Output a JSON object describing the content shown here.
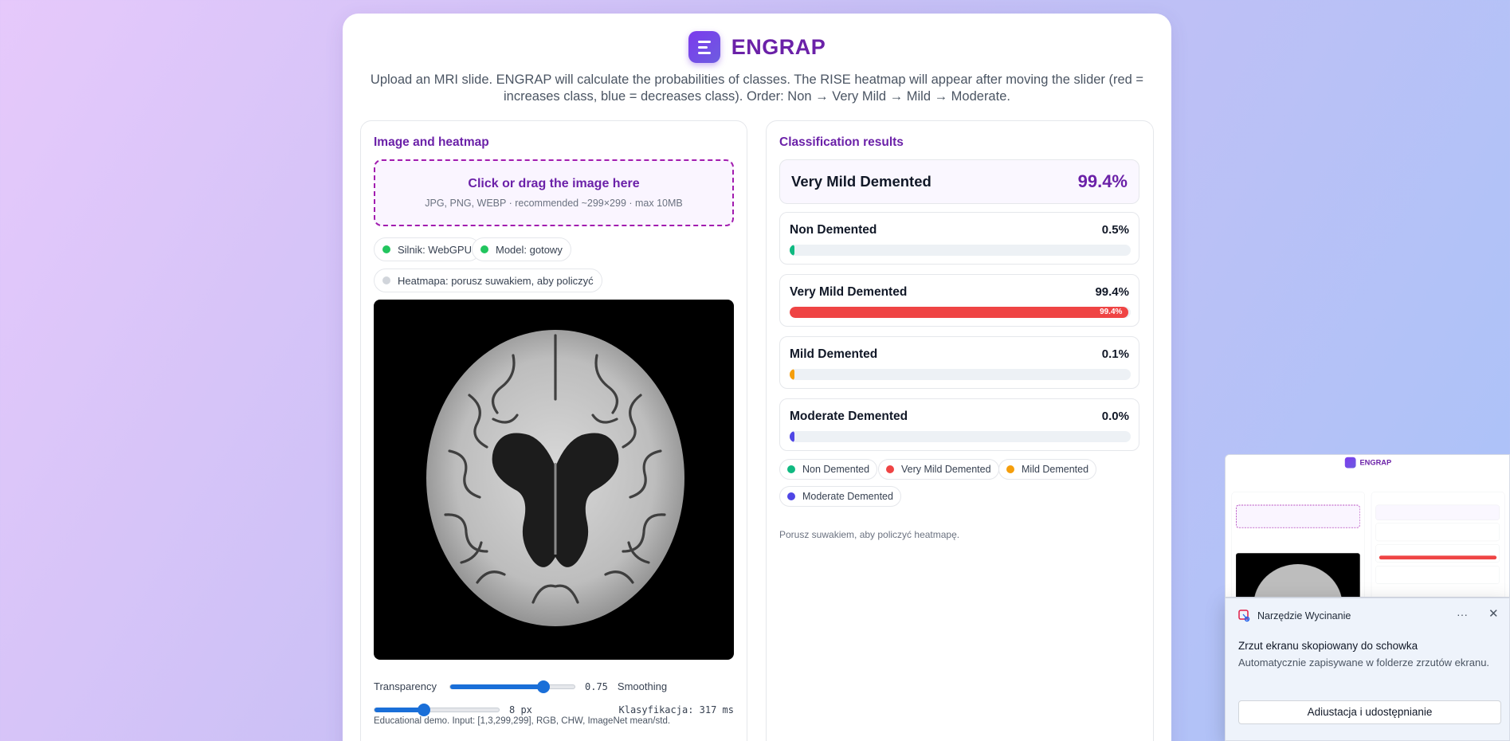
{
  "header": {
    "title": "ENGRAP",
    "subtitle": "Upload an MRI slide. ENGRAP will calculate the probabilities of classes. The RISE heatmap will appear after moving the slider (red = increases class, blue = decreases class). Order: Non → Very Mild → Mild → Moderate."
  },
  "left_panel": {
    "title": "Image and heatmap",
    "dropzone": {
      "main": "Click or drag the image here",
      "sub": "JPG, PNG, WEBP · recommended ~299×299 · max 10MB"
    },
    "status_chips": [
      {
        "label": "Silnik: WebGPU",
        "color": "#22c55e"
      },
      {
        "label": "Model: gotowy",
        "color": "#22c55e"
      },
      {
        "label": "Heatmapa: porusz suwakiem, aby policzyć",
        "color": "#d1d5db"
      }
    ],
    "controls": {
      "transparency_label": "Transparency",
      "transparency_value": "0.75",
      "transparency_level": 0.75,
      "smoothing_label": "Smoothing",
      "smoothing_value": "8 px",
      "smoothing_level": 0.4,
      "classification_time": "Klasyfikacja: 317 ms"
    },
    "footnote": "Educational demo. Input: [1,3,299,299], RGB, CHW, ImageNet mean/std."
  },
  "right_panel": {
    "title": "Classification results",
    "top_result": {
      "label": "Very Mild Demented",
      "value": "99.4%"
    },
    "classes": [
      {
        "name": "Non Demented",
        "pct": "0.5%",
        "level": 0.005,
        "color": "#10b981",
        "inner": ""
      },
      {
        "name": "Very Mild Demented",
        "pct": "99.4%",
        "level": 0.994,
        "color": "#ef4444",
        "inner": "99.4%"
      },
      {
        "name": "Mild Demented",
        "pct": "0.1%",
        "level": 0.001,
        "color": "#f59e0b",
        "inner": ""
      },
      {
        "name": "Moderate Demented",
        "pct": "0.0%",
        "level": 0.0,
        "color": "#4f46e5",
        "inner": ""
      }
    ],
    "legend": [
      {
        "label": "Non Demented",
        "color": "#10b981"
      },
      {
        "label": "Very Mild Demented",
        "color": "#ef4444"
      },
      {
        "label": "Mild Demented",
        "color": "#f59e0b"
      },
      {
        "label": "Moderate Demented",
        "color": "#4f46e5"
      }
    ],
    "hint": "Porusz suwakiem, aby policzyć heatmapę."
  },
  "snip_toast": {
    "app_name": "Narzędzie Wycinanie",
    "more": "···",
    "close": "✕",
    "title": "Zrzut ekranu skopiowany do schowka",
    "body": "Automatycznie zapisywane w folderze zrzutów ekranu.",
    "button": "Adiustacja i udostępnianie"
  }
}
